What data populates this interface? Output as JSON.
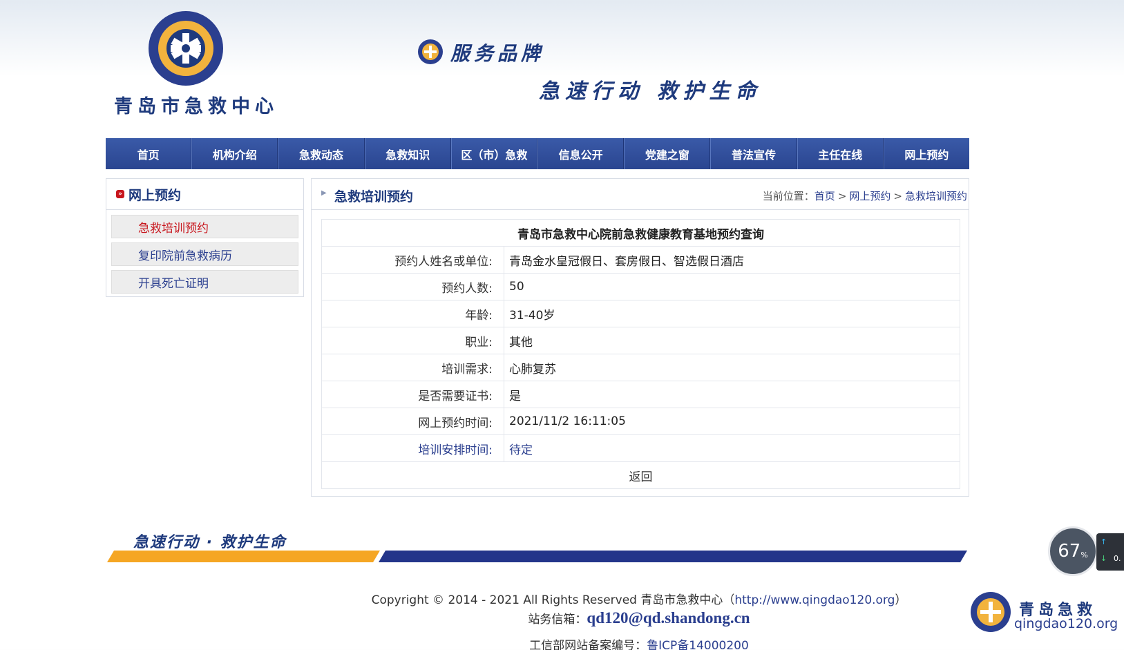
{
  "header": {
    "logo_name": "青岛市急救中心",
    "brand_label": "服务品牌",
    "slogan": "急速行动 救护生命"
  },
  "nav": {
    "items": [
      "首页",
      "机构介绍",
      "急救动态",
      "急救知识",
      "区（市）急救",
      "信息公开",
      "党建之窗",
      "普法宣传",
      "主任在线",
      "网上预约"
    ]
  },
  "sidebar": {
    "title": "网上预约",
    "items": [
      {
        "label": "急救培训预约",
        "active": true
      },
      {
        "label": "复印院前急救病历",
        "active": false
      },
      {
        "label": "开具死亡证明",
        "active": false
      }
    ]
  },
  "main": {
    "title": "急救培训预约",
    "breadcrumb": {
      "prefix": "当前位置：",
      "home": "首页",
      "sep": ">",
      "section": "网上预约",
      "current": "急救培训预约"
    },
    "table": {
      "caption": "青岛市急救中心院前急救健康教育基地预约查询",
      "rows": [
        {
          "label": "预约人姓名或单位:",
          "value": "青岛金水皇冠假日、套房假日、智选假日酒店"
        },
        {
          "label": "预约人数:",
          "value": "50"
        },
        {
          "label": "年龄:",
          "value": "31-40岁"
        },
        {
          "label": "职业:",
          "value": "其他"
        },
        {
          "label": "培训需求:",
          "value": "心肺复苏"
        },
        {
          "label": "是否需要证书:",
          "value": "是"
        },
        {
          "label": "网上预约时间:",
          "value": "2021/11/2 16:11:05"
        },
        {
          "label": "培训安排时间:",
          "value": "待定"
        }
      ],
      "back_label": "返回"
    }
  },
  "footer": {
    "slogan": "急速行动 · 救护生命",
    "copyright": "Copyright © 2014 - 2021  All Rights Reserved  青岛市急救中心（",
    "site_url": "http://www.qingdao120.org",
    "copyright_end": "）",
    "email_label": "站务信箱：",
    "email": "qd120@qd.shandong.cn",
    "icp_label": "工信部网站备案编号：",
    "icp": "鲁ICP备14000200",
    "logo_name": "青岛急救",
    "logo_url": "qingdao120.org"
  },
  "widget": {
    "percent": "67",
    "percent_unit": "%",
    "side_value": "0."
  },
  "colors": {
    "brand_blue": "#1e3a7d",
    "nav_blue": "#2a4590",
    "accent_red": "#c8161d",
    "accent_yellow": "#f5a623"
  }
}
